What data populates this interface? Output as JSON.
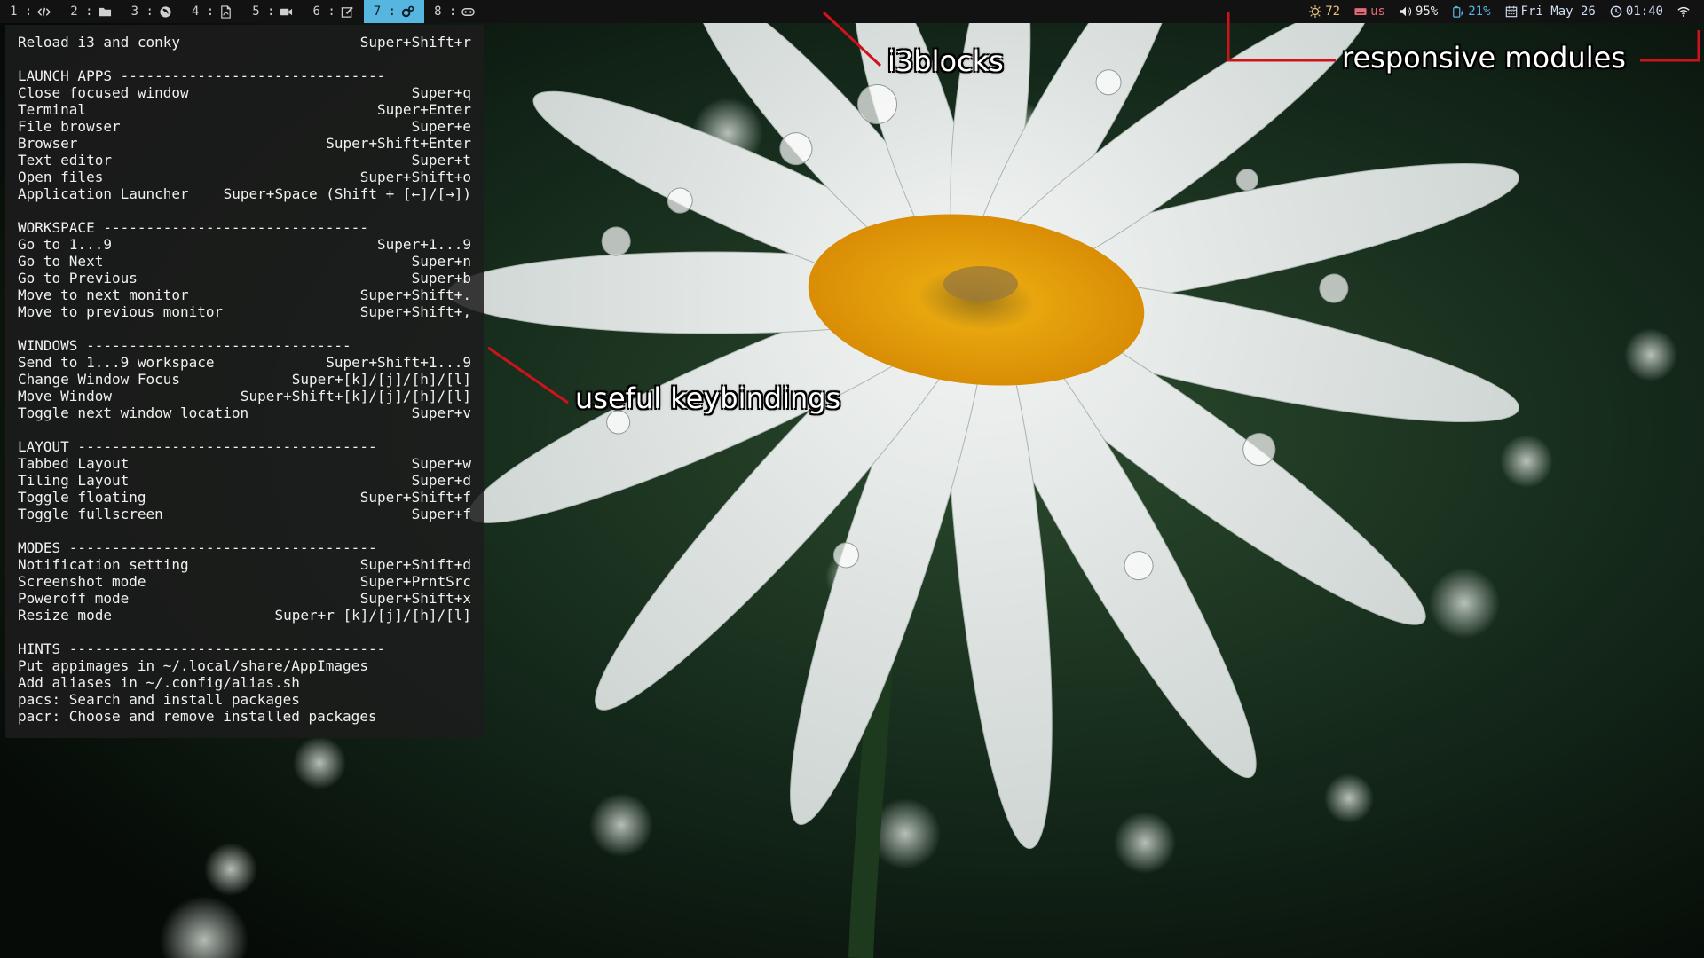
{
  "workspaces": [
    {
      "label": "1 :",
      "icon": "code-icon",
      "active": false
    },
    {
      "label": "2 :",
      "icon": "folder-icon",
      "active": false
    },
    {
      "label": "3 :",
      "icon": "firefox-icon",
      "active": false
    },
    {
      "label": "4 :",
      "icon": "pdf-document-icon",
      "active": false
    },
    {
      "label": "5 :",
      "icon": "video-camera-icon",
      "active": false
    },
    {
      "label": "6 :",
      "icon": "edit-icon",
      "active": false
    },
    {
      "label": "7 :",
      "icon": "cogs-icon",
      "active": true
    },
    {
      "label": "8 :",
      "icon": "gamepad-icon",
      "active": false
    }
  ],
  "status": {
    "temperature": "72",
    "keyboard_layout": "us",
    "volume": "95%",
    "battery": "21%",
    "date": "Fri May 26",
    "time": "01:40"
  },
  "colors": {
    "active_workspace": "#56b6e0",
    "temperature": "#e5c07b",
    "keyboard": "#e06c75",
    "battery": "#56b6e0",
    "annotation_line": "#d0121b"
  },
  "conky": {
    "reload": {
      "label": "Reload i3 and conky",
      "key": "Super+Shift+r"
    },
    "sections": [
      {
        "title": "LAUNCH APPS -------------------------------",
        "rows": [
          {
            "label": "Close focused window",
            "key": "Super+q"
          },
          {
            "label": "Terminal",
            "key": "Super+Enter"
          },
          {
            "label": "File browser",
            "key": "Super+e"
          },
          {
            "label": "Browser",
            "key": "Super+Shift+Enter"
          },
          {
            "label": "Text editor",
            "key": "Super+t"
          },
          {
            "label": "Open files",
            "key": "Super+Shift+o"
          },
          {
            "label": "Application Launcher",
            "key": "Super+Space (Shift + [←]/[→])"
          }
        ]
      },
      {
        "title": "WORKSPACE -------------------------------",
        "rows": [
          {
            "label": "Go to 1...9",
            "key": "Super+1...9"
          },
          {
            "label": "Go to Next",
            "key": "Super+n"
          },
          {
            "label": "Go to Previous",
            "key": "Super+b"
          },
          {
            "label": "Move to next monitor",
            "key": "Super+Shift+."
          },
          {
            "label": "Move to previous monitor",
            "key": "Super+Shift+,"
          }
        ]
      },
      {
        "title": "WINDOWS -------------------------------",
        "rows": [
          {
            "label": "Send to 1...9 workspace",
            "key": "Super+Shift+1...9"
          },
          {
            "label": "Change Window Focus",
            "key": "Super+[k]/[j]/[h]/[l]"
          },
          {
            "label": "Move Window",
            "key": "Super+Shift+[k]/[j]/[h]/[l]"
          },
          {
            "label": "Toggle next window location",
            "key": "Super+v"
          }
        ]
      },
      {
        "title": "LAYOUT -----------------------------------",
        "rows": [
          {
            "label": "Tabbed Layout",
            "key": "Super+w"
          },
          {
            "label": "Tiling Layout",
            "key": "Super+d"
          },
          {
            "label": "Toggle floating",
            "key": "Super+Shift+f"
          },
          {
            "label": "Toggle fullscreen",
            "key": "Super+f"
          }
        ]
      },
      {
        "title": "MODES ------------------------------------",
        "rows": [
          {
            "label": "Notification setting",
            "key": "Super+Shift+d"
          },
          {
            "label": "Screenshot mode",
            "key": "Super+PrntSrc"
          },
          {
            "label": "Poweroff mode",
            "key": "Super+Shift+x"
          },
          {
            "label": "Resize mode",
            "key": "Super+r [k]/[j]/[h]/[l]"
          }
        ]
      }
    ],
    "hints": {
      "title": "HINTS -------------------------------------",
      "lines": [
        "Put appimages in ~/.local/share/AppImages",
        "Add aliases in ~/.config/alias.sh",
        "pacs: Search and install packages",
        "pacr: Choose and remove installed packages"
      ]
    }
  },
  "annotations": {
    "i3blocks": "i3blocks",
    "responsive": "responsive modules",
    "keybindings": "useful keybindings"
  }
}
